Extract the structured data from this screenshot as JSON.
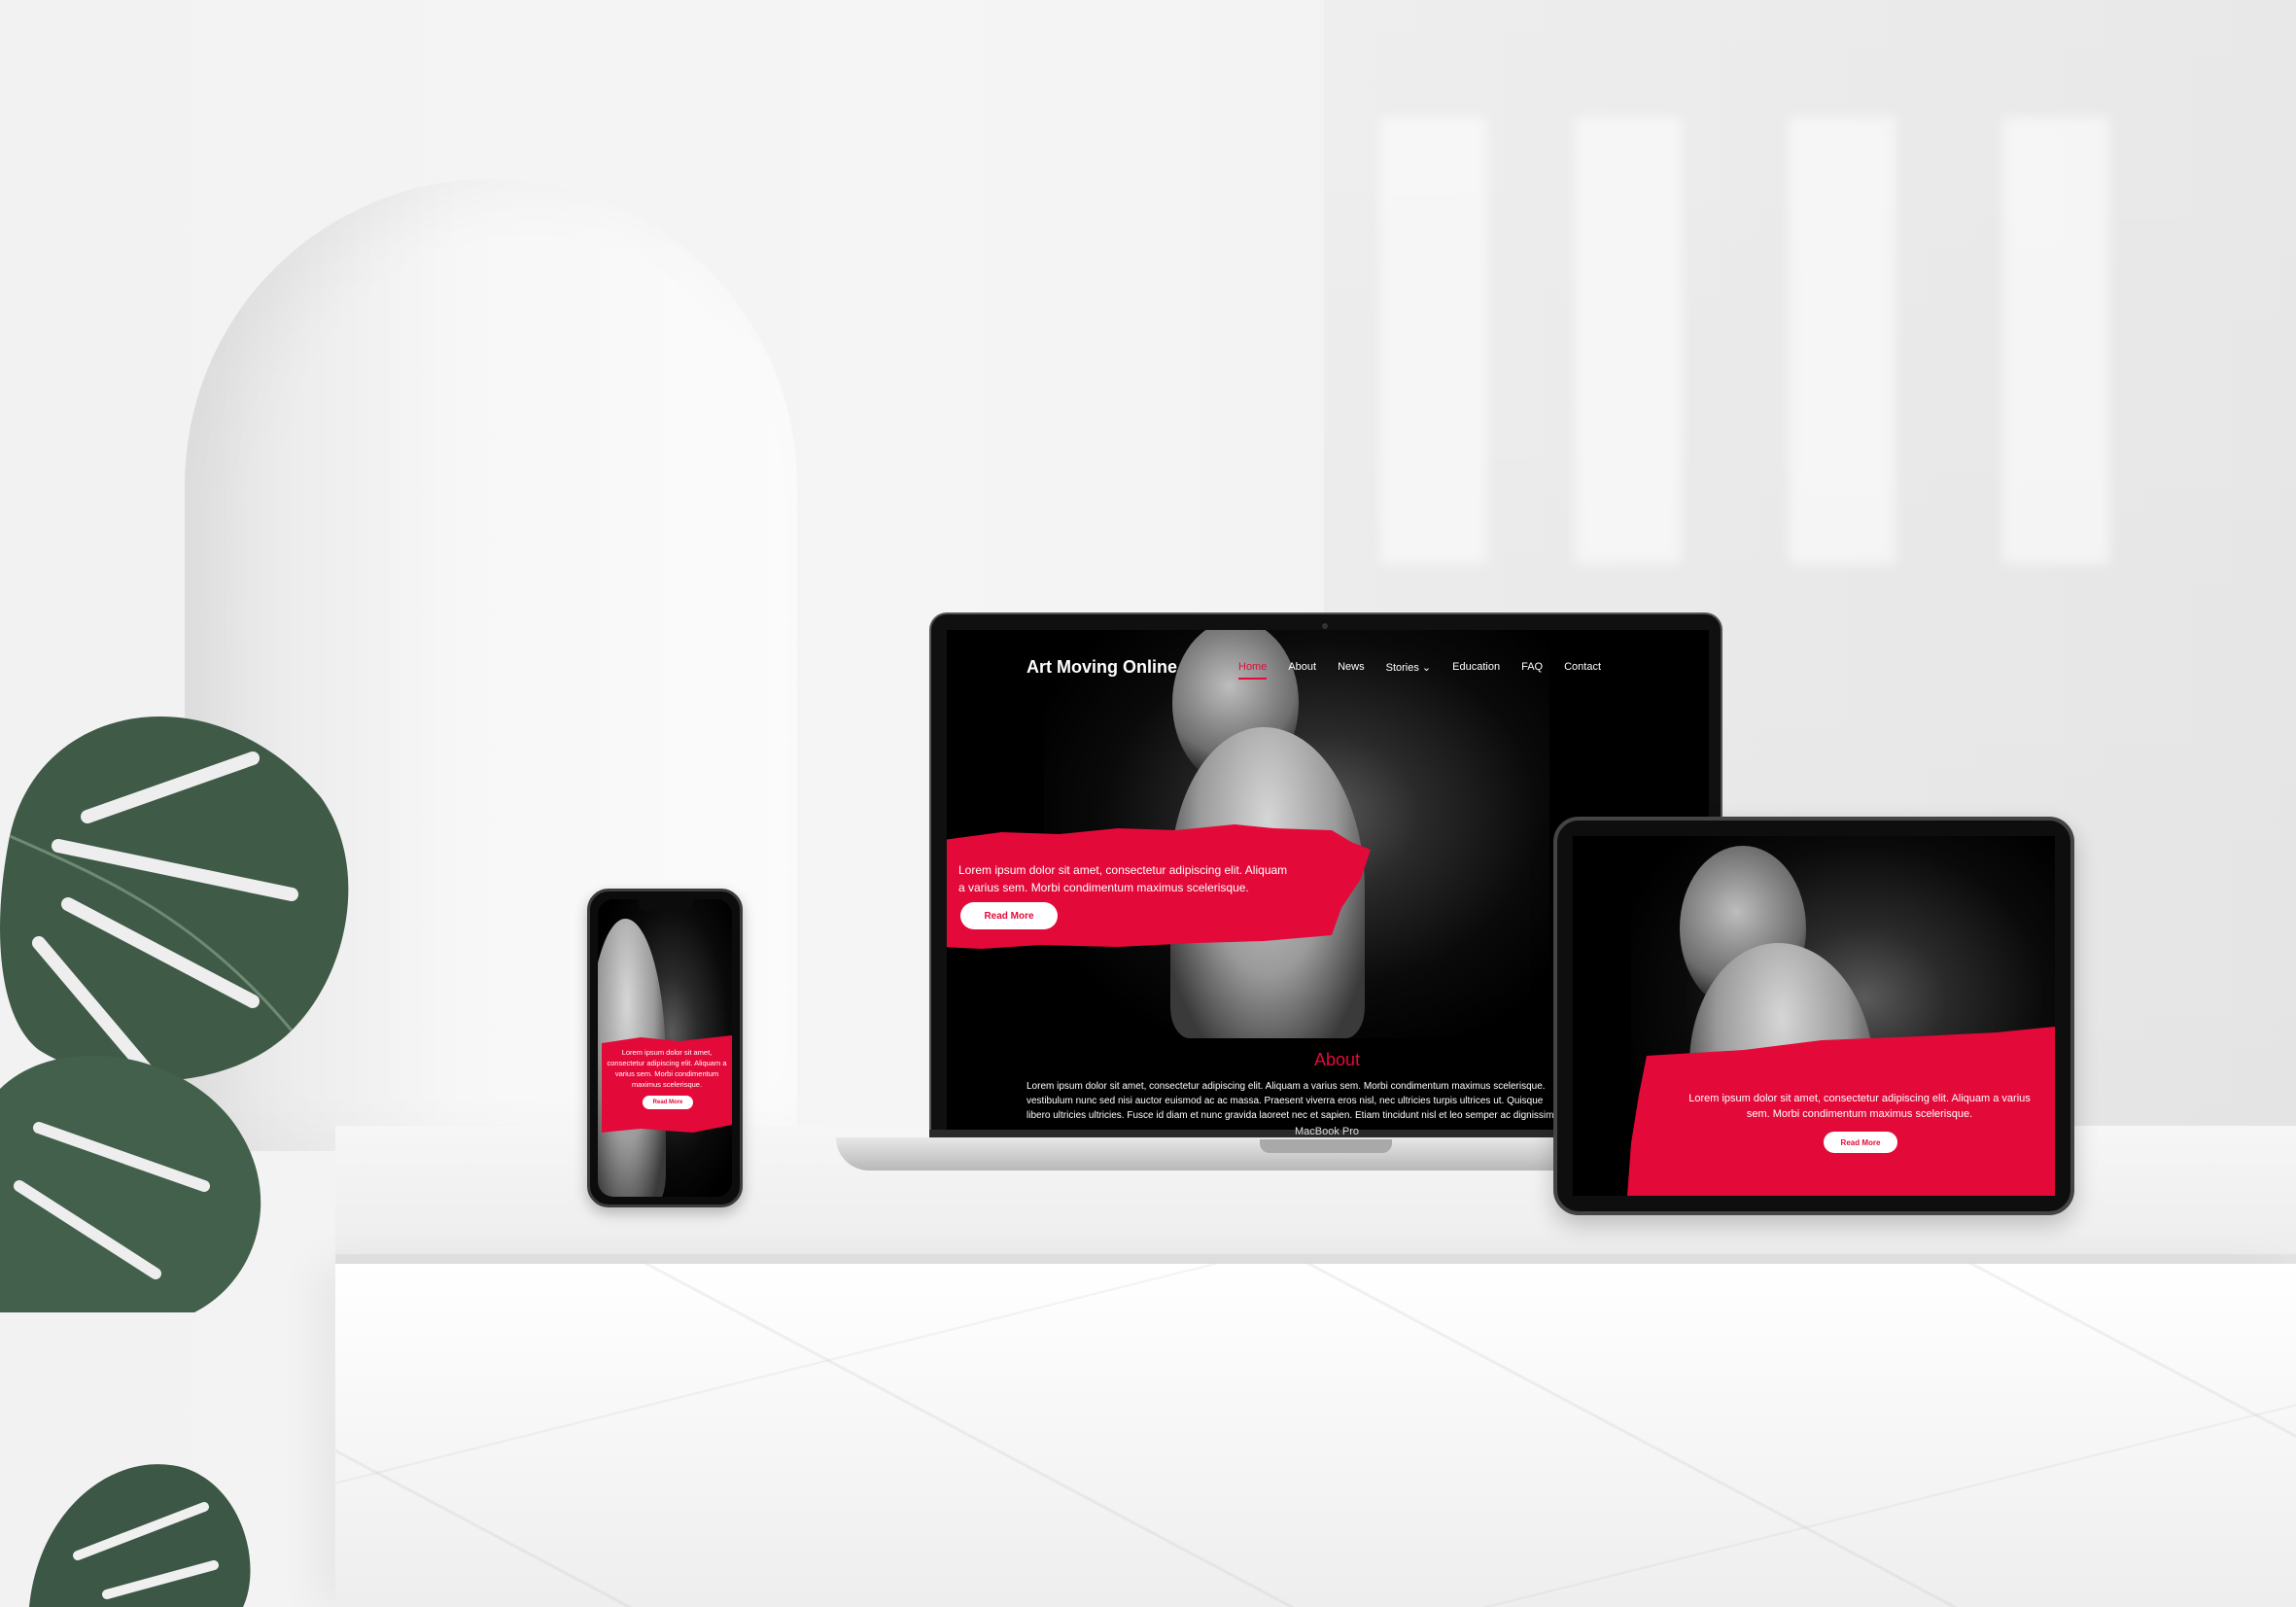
{
  "site": {
    "brand": "Art Moving Online",
    "nav": [
      "Home",
      "About",
      "News",
      "Stories",
      "Education",
      "FAQ",
      "Contact"
    ],
    "nav_active": "Home",
    "hero_text_line1": "Lorem ipsum dolor sit amet, consectetur adipiscing elit. Aliquam",
    "hero_text_line2": "a varius sem. Morbi condimentum maximus scelerisque.",
    "read_more": "Read More",
    "about_title": "About",
    "about_line1": "Lorem ipsum dolor sit amet, consectetur adipiscing elit. Aliquam a varius sem. Morbi condimentum maximus scelerisque.",
    "about_line2": "vestibulum nunc sed nisi auctor euismod ac ac massa. Praesent viverra eros nisl, nec ultricies turpis ultrices ut. Quisque",
    "about_line3": "libero ultricies ultricies. Fusce id diam et nunc gravida laoreet nec et sapien. Etiam tincidunt nisl et leo semper ac dignissim"
  },
  "phone": {
    "hero_line1": "Lorem ipsum dolor sit amet,",
    "hero_line2": "consectetur adipiscing elit. Aliquam a",
    "hero_line3": "varius sem. Morbi condimentum",
    "hero_line4": "maximus scelerisque.",
    "read_more": "Read More"
  },
  "tablet": {
    "hero_line1": "Lorem ipsum dolor sit amet, consectetur adipiscing elit. Aliquam a varius",
    "hero_line2": "sem. Morbi condimentum maximus scelerisque.",
    "read_more": "Read More"
  },
  "device_label": "MacBook Pro",
  "colors": {
    "accent": "#e30a3a",
    "screen_bg": "#000000",
    "plant": "#3f5a47"
  }
}
